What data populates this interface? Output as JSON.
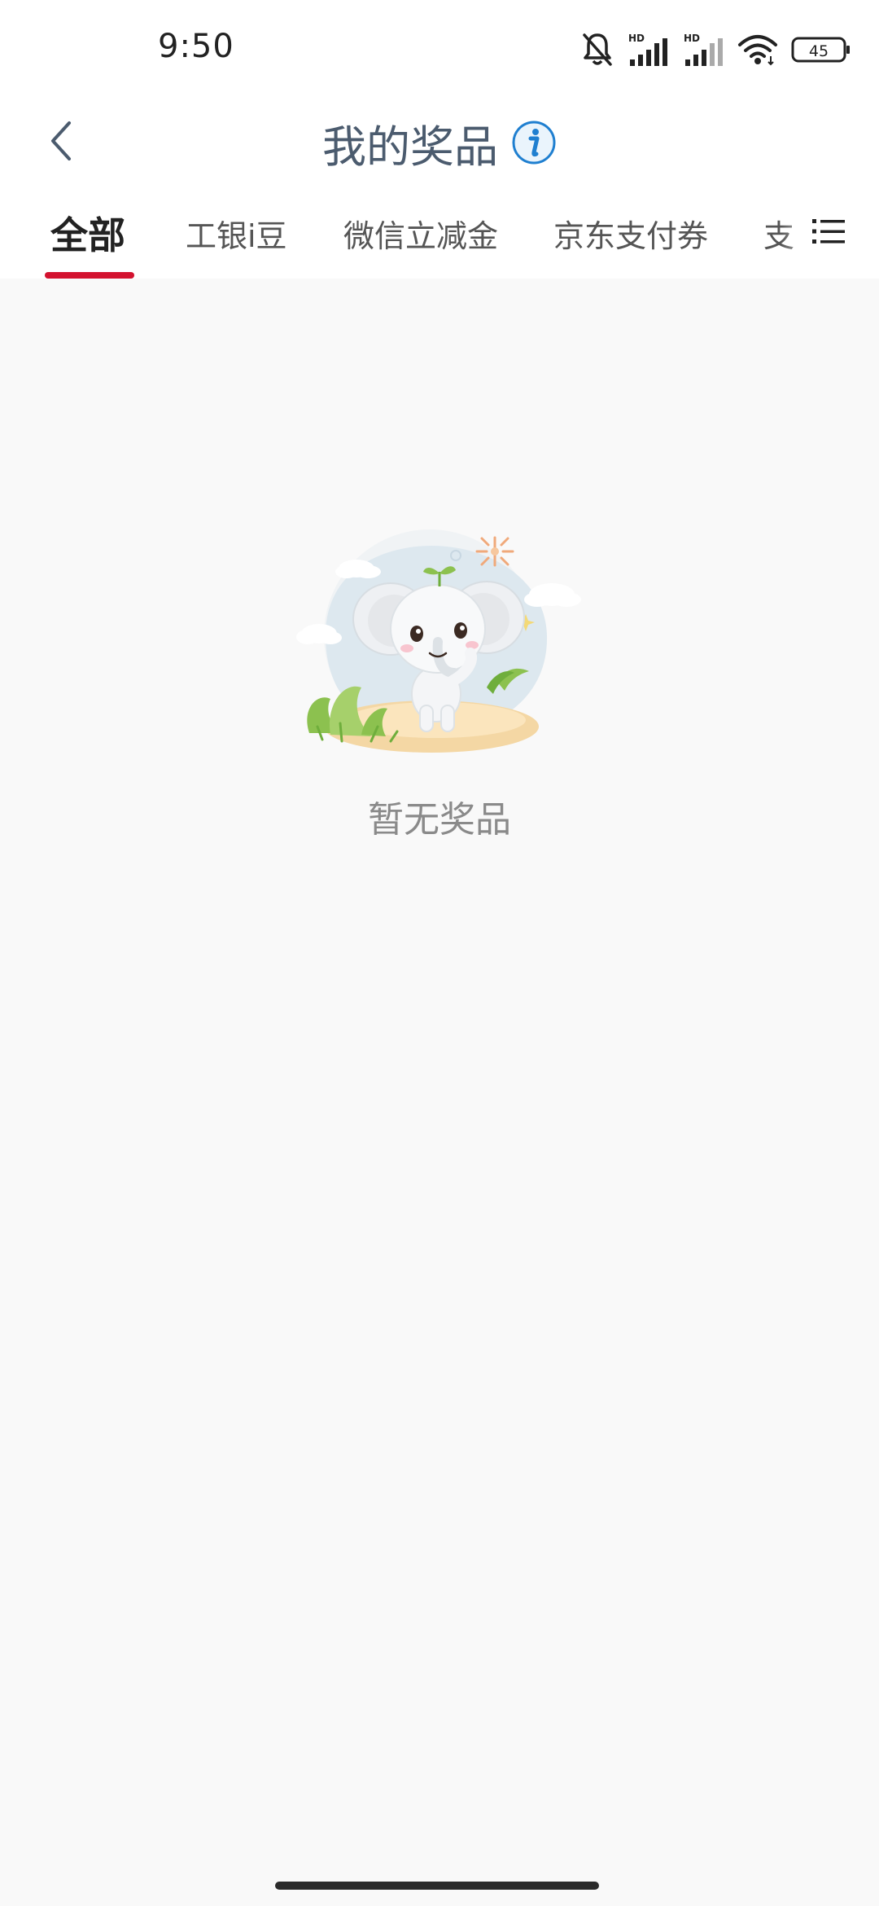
{
  "status_bar": {
    "time": "9:50",
    "signal_1_label": "HD",
    "signal_2_label": "HD",
    "battery": "45",
    "icons": [
      "bell-muted-icon",
      "signal-hd-icon",
      "signal-hd-icon",
      "wifi-icon",
      "battery-icon"
    ]
  },
  "header": {
    "title": "我的奖品",
    "back_icon": "chevron-left-icon",
    "info_icon": "info-icon"
  },
  "tabs": [
    {
      "label": "全部",
      "active": true
    },
    {
      "label": "工银i豆",
      "active": false
    },
    {
      "label": "微信立减金",
      "active": false
    },
    {
      "label": "京东支付券",
      "active": false
    },
    {
      "label": "支",
      "active": false
    }
  ],
  "menu_icon": "list-menu-icon",
  "empty_state": {
    "illustration": "elephant-mascot-illustration",
    "text": "暂无奖品"
  },
  "colors": {
    "accent": "#d3122f",
    "title": "#4b5b6e",
    "info_blue": "#1f7fd0",
    "background": "#f9f9f9"
  }
}
